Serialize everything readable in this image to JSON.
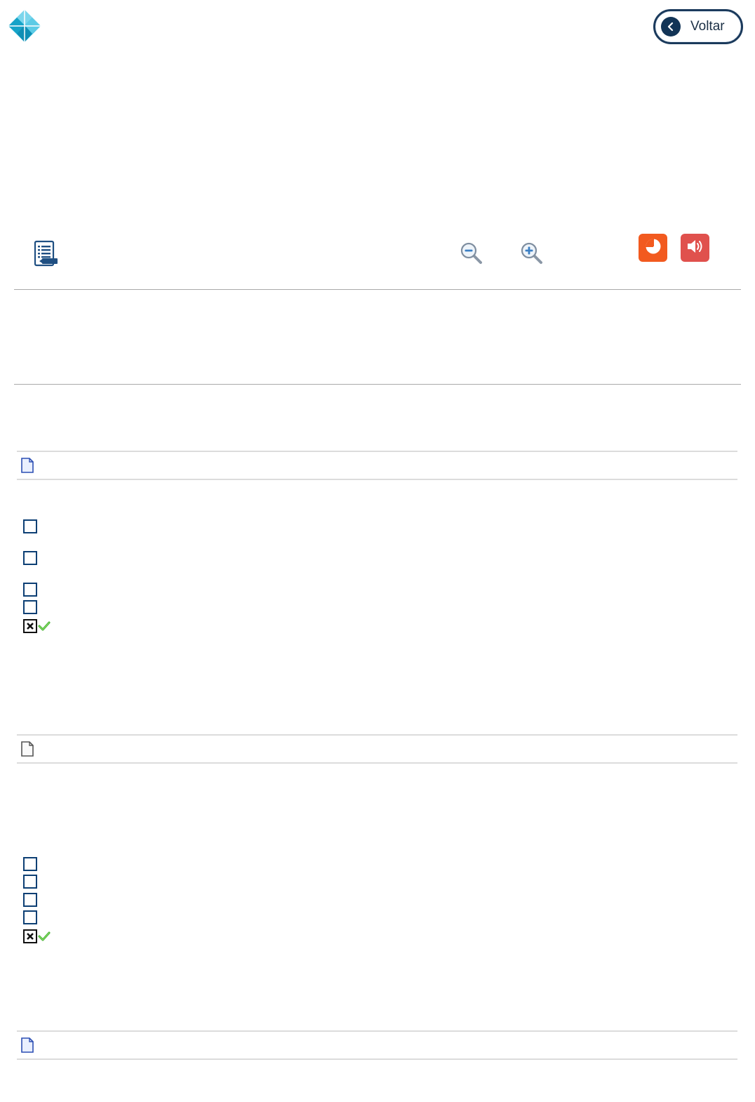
{
  "header": {
    "logo_icon": "diamond-logo-icon",
    "back_button_label": "Voltar",
    "back_icon": "chevron-left-icon"
  },
  "toolbar": {
    "toc_icon": "table-of-contents-icon",
    "zoom_out_icon": "zoom-out-icon",
    "zoom_in_icon": "zoom-in-icon",
    "chart_icon": "pie-chart-icon",
    "audio_icon": "speaker-icon",
    "colors": {
      "chart": "#f25a1f",
      "audio": "#e0514d",
      "accent": "#1b3a5c"
    }
  },
  "questions": [
    {
      "doc_icon": "document-icon",
      "options": [
        {
          "checked": false
        },
        {
          "checked": false
        },
        {
          "checked": false
        },
        {
          "checked": false
        },
        {
          "checked": true,
          "correct": true
        }
      ]
    },
    {
      "doc_icon": "document-icon",
      "options": [
        {
          "checked": false
        },
        {
          "checked": false
        },
        {
          "checked": false
        },
        {
          "checked": false
        },
        {
          "checked": true,
          "correct": true
        }
      ]
    },
    {
      "doc_icon": "document-icon",
      "options": []
    }
  ]
}
